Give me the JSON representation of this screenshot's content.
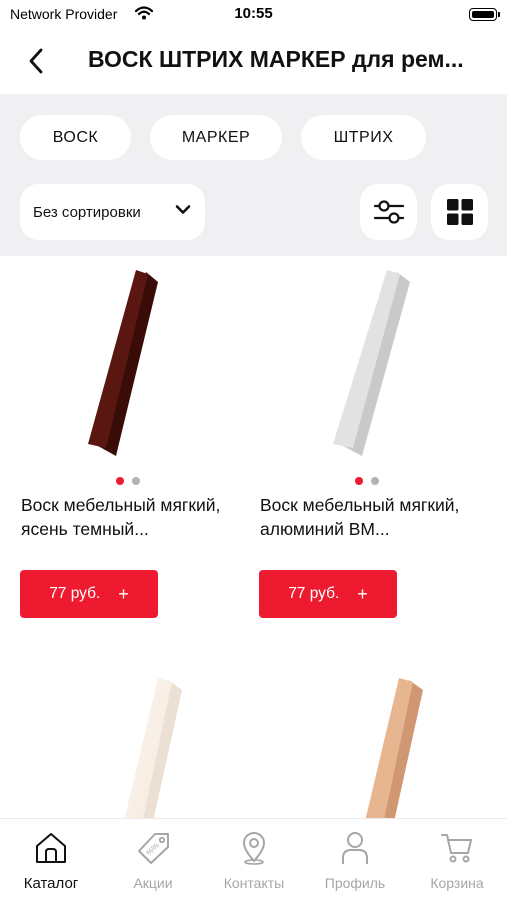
{
  "status_bar": {
    "carrier": "Network Provider",
    "time": "10:55"
  },
  "header": {
    "title": "ВОСК ШТРИХ МАРКЕР для рем..."
  },
  "tabs": [
    {
      "label": "ВОСК",
      "active": true
    },
    {
      "label": "МАРКЕР",
      "active": false
    },
    {
      "label": "ШТРИХ",
      "active": false
    }
  ],
  "sort": {
    "selected": "Без сортировки"
  },
  "products": [
    {
      "name": "Воск мебельный мягкий, ясень темный...",
      "price": "77 руб.",
      "add_symbol": "+",
      "color": "#5a1712",
      "images_count": 2,
      "active_image": 0
    },
    {
      "name": "Воск мебельный мягкий, алюминий ВМ...",
      "price": "77 руб.",
      "add_symbol": "+",
      "color": "#e2e2e2",
      "images_count": 2,
      "active_image": 0
    },
    {
      "name": "",
      "price": "",
      "color": "#f6ede4"
    },
    {
      "name": "",
      "price": "",
      "color": "#e7b590"
    }
  ],
  "bottom_nav": [
    {
      "label": "Каталог",
      "icon": "home-icon",
      "active": true
    },
    {
      "label": "Акции",
      "icon": "tag-icon",
      "active": false
    },
    {
      "label": "Контакты",
      "icon": "location-pin-icon",
      "active": false
    },
    {
      "label": "Профиль",
      "icon": "user-icon",
      "active": false
    },
    {
      "label": "Корзина",
      "icon": "cart-icon",
      "active": false
    }
  ],
  "colors": {
    "accent": "#ee1a2f",
    "panel_bg": "#f0f0f2",
    "inactive_nav": "#a6a6a6"
  }
}
